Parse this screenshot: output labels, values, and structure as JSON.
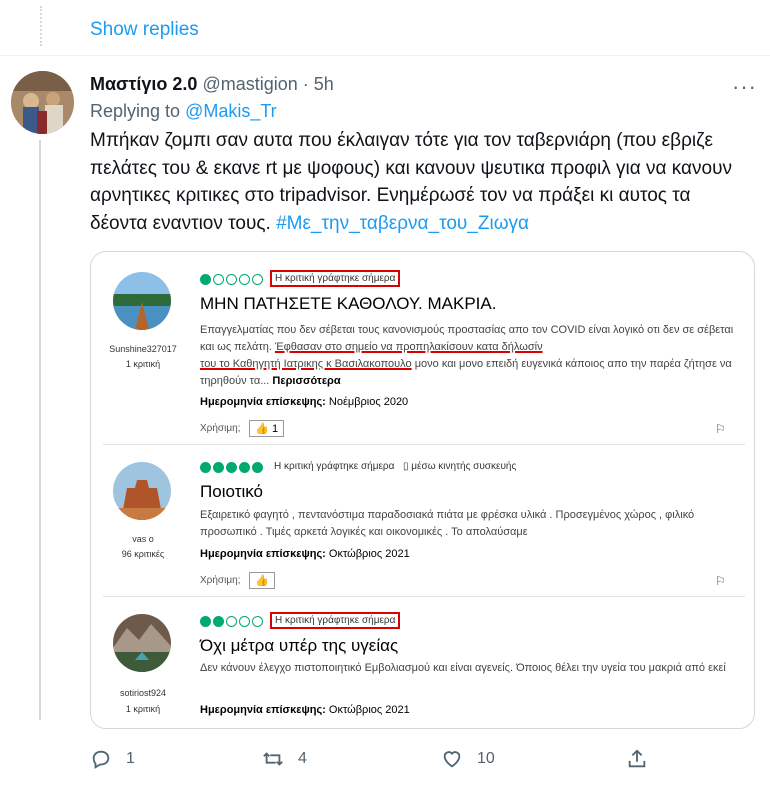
{
  "show_replies": "Show replies",
  "tweet": {
    "name": "Μαστίγιο 2.0",
    "handle": "@mastigion",
    "sep": "·",
    "time": "5h",
    "more": "···",
    "replying_prefix": "Replying to ",
    "replying_to": "@Makis_Tr",
    "text_main": "Μπήκαν ζομπι σαν αυτα που έκλαιγαν τότε για τον ταβερνιάρη (που εβριζε πελάτες του & εκανε rt με ψοφους) και κανουν ψευτικα προφιλ για να κανουν αρνητικες κριτικες στο tripadvisor. Ενημέρωσέ τον να πράξει κι αυτος τα δέοντα εναντιον τους. ",
    "hashtag": "#Με_την_ταβερνα_του_Ζιωγα"
  },
  "reviews": [
    {
      "user": "Sunshine327017",
      "count": "1 κριτική",
      "rating": 1,
      "date": "Η κριτική γράφτηκε σήμερα",
      "title": "ΜΗΝ ΠΑΤΗΣΕΤΕ ΚΑΘΟΛΟΥ. ΜΑΚΡΙΑ.",
      "body_a": "Επαγγελματίας που δεν σέβεται τους κανονισμούς προστασίας απο τον COVID είναι λογικό οτι δεν σε σέβεται και ως πελάτη. ",
      "body_ul1": "Έφθασαν στο σημείο να προπηλακίσουν κατα δήλωσίν",
      "body_ul2": "του το Καθηγητή Ιατρικης κ Βασιλακοπουλο",
      "body_b": " μονο και μονο επειδή ευγενικά κάποιος απο την παρέα ζήτησε να τηρηθούν τα... ",
      "more": "Περισσότερα",
      "visit_label": "Ημερομηνία επίσκεψης:",
      "visit_value": " Νοέμβριος 2020",
      "helpful": "Χρήσιμη;",
      "likes": "1"
    },
    {
      "user": "vas o",
      "count": "96 κριτικές",
      "rating": 5,
      "date": "Η κριτική γράφτηκε σήμερα",
      "mobile": "μέσω κινητής συσκευής",
      "title": "Ποιοτικό",
      "body": "Εξαιρετικό φαγητό , πεντανόστιμα παραδοσιακά πιάτα με φρέσκα υλικά . Προσεγμένος χώρος , φιλικό προσωπικό . Τιμές αρκετά λογικές και οικονομικές . Το απολαύσαμε",
      "visit_label": "Ημερομηνία επίσκεψης:",
      "visit_value": " Οκτώβριος 2021",
      "helpful": "Χρήσιμη;"
    },
    {
      "user": "sotiriost924",
      "count": "1 κριτική",
      "rating": 2,
      "date": "Η κριτική γράφτηκε σήμερα",
      "title": "Όχι μέτρα υπέρ της υγείας",
      "body": "Δεν κάνουν έλεγχο πιστοποιητικό Εμβολιασμού και είναι αγενείς. Όποιος θέλει την υγεία του μακριά από εκεί",
      "visit_label": "Ημερομηνία επίσκεψης:",
      "visit_value": " Οκτώβριος 2021"
    }
  ],
  "actions": {
    "replies": "1",
    "retweets": "4",
    "likes": "10"
  },
  "colors": {
    "accent": "#1d9bf0",
    "tripadvisor_green": "#00aa6c",
    "highlight_red": "#dd0000"
  }
}
